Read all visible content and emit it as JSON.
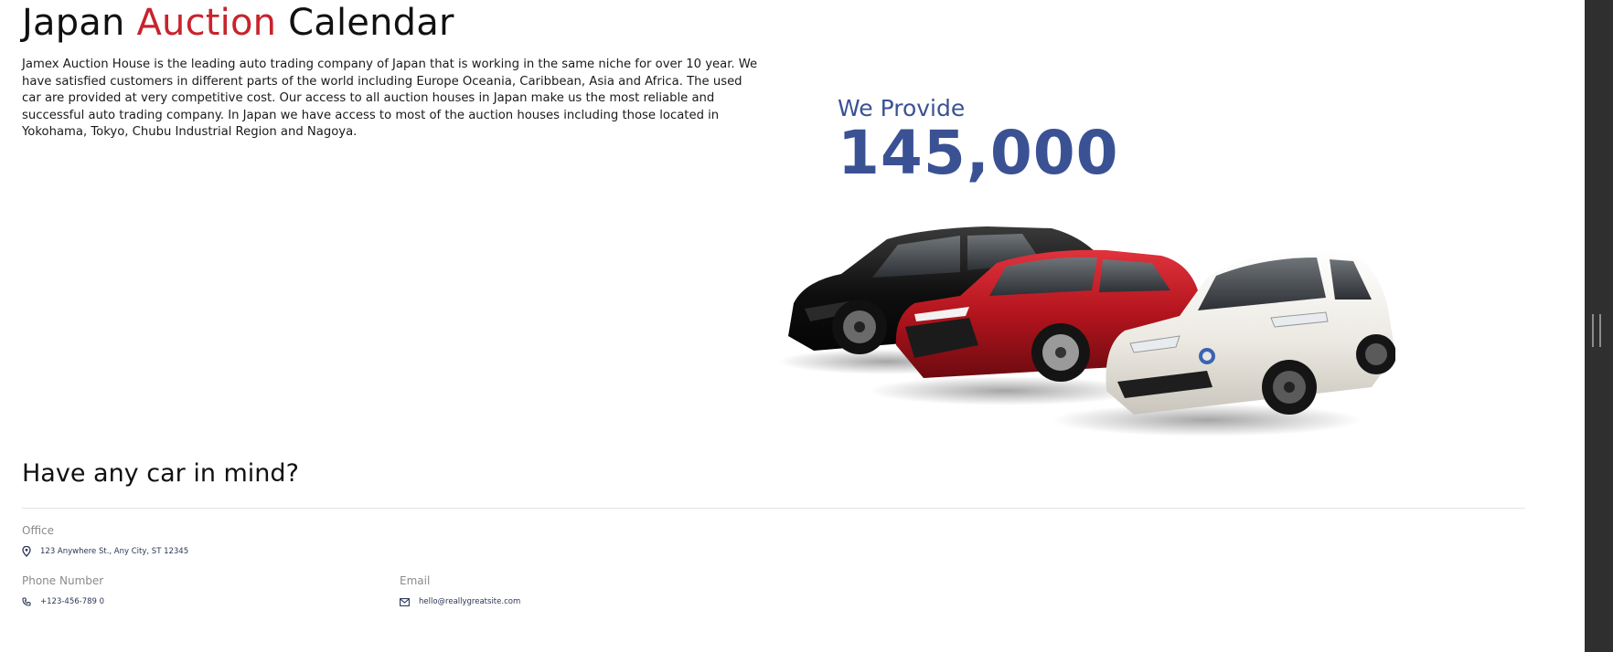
{
  "header": {
    "title_part1": "Japan ",
    "title_accent": "Auction",
    "title_part2": " Calendar"
  },
  "intro": {
    "text": "Jamex Auction House is the leading auto trading company of Japan that is working in the same niche for over 10 year. We have satisfied customers in different parts of the world including Europe Oceania, Caribbean, Asia and Africa. The used car are provided at very competitive cost. Our access to all auction houses in Japan make us the most reliable and successful auto trading company. In Japan we have access to most of the auction houses including those located in Yokohama, Tokyo, Chubu Industrial Region and Nagoya."
  },
  "stats": {
    "lead": "We Provide",
    "value": "145,000"
  },
  "cars_image": {
    "description_icon": "three-cars-image"
  },
  "contact": {
    "title": "Have any car in mind?",
    "office_label": "Office",
    "office_address": "123 Anywhere St., Any City, ST 12345",
    "phone_label": "Phone Number",
    "phone_value": "+123-456-789 0",
    "email_label": "Email",
    "email_value": "hello@reallygreatsite.com"
  },
  "colors": {
    "accent_red": "#c8232c",
    "brand_blue": "#3a5294",
    "scrollbar": "#2f2f2f"
  },
  "icons": {
    "address": "map-pin-icon",
    "phone": "phone-icon",
    "email": "envelope-icon"
  }
}
